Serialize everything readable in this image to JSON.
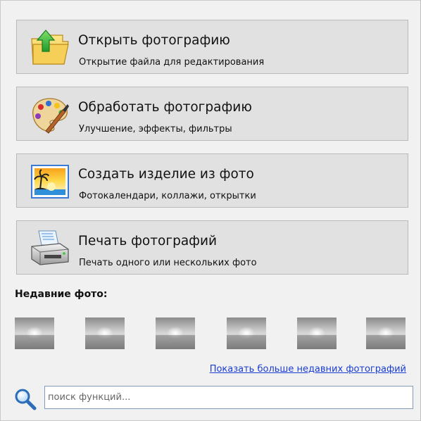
{
  "actions": [
    {
      "title": "Открыть фотографию",
      "subtitle": "Открытие файла для редактирования",
      "icon": "open-folder-icon"
    },
    {
      "title": "Обработать фотографию",
      "subtitle": "Улучшение, эффекты, фильтры",
      "icon": "palette-icon"
    },
    {
      "title": "Создать изделие из фото",
      "subtitle": "Фотокалендари, коллажи, открытки",
      "icon": "sunset-photo-icon"
    },
    {
      "title": "Печать фотографий",
      "subtitle": "Печать одного или нескольких фото",
      "icon": "printer-icon"
    }
  ],
  "recent": {
    "label": "Недавние фото:",
    "thumbnail_count": 6,
    "more_link": "Показать больше недавних фотографий"
  },
  "search": {
    "placeholder": "поиск функций...",
    "value": "",
    "icon": "magnifier-icon"
  },
  "colors": {
    "background": "#f1f1f1",
    "button_face": "#e1e1e1",
    "button_border": "#b9b9b9",
    "link": "#1a3dd0",
    "input_border": "#7f9db9"
  }
}
